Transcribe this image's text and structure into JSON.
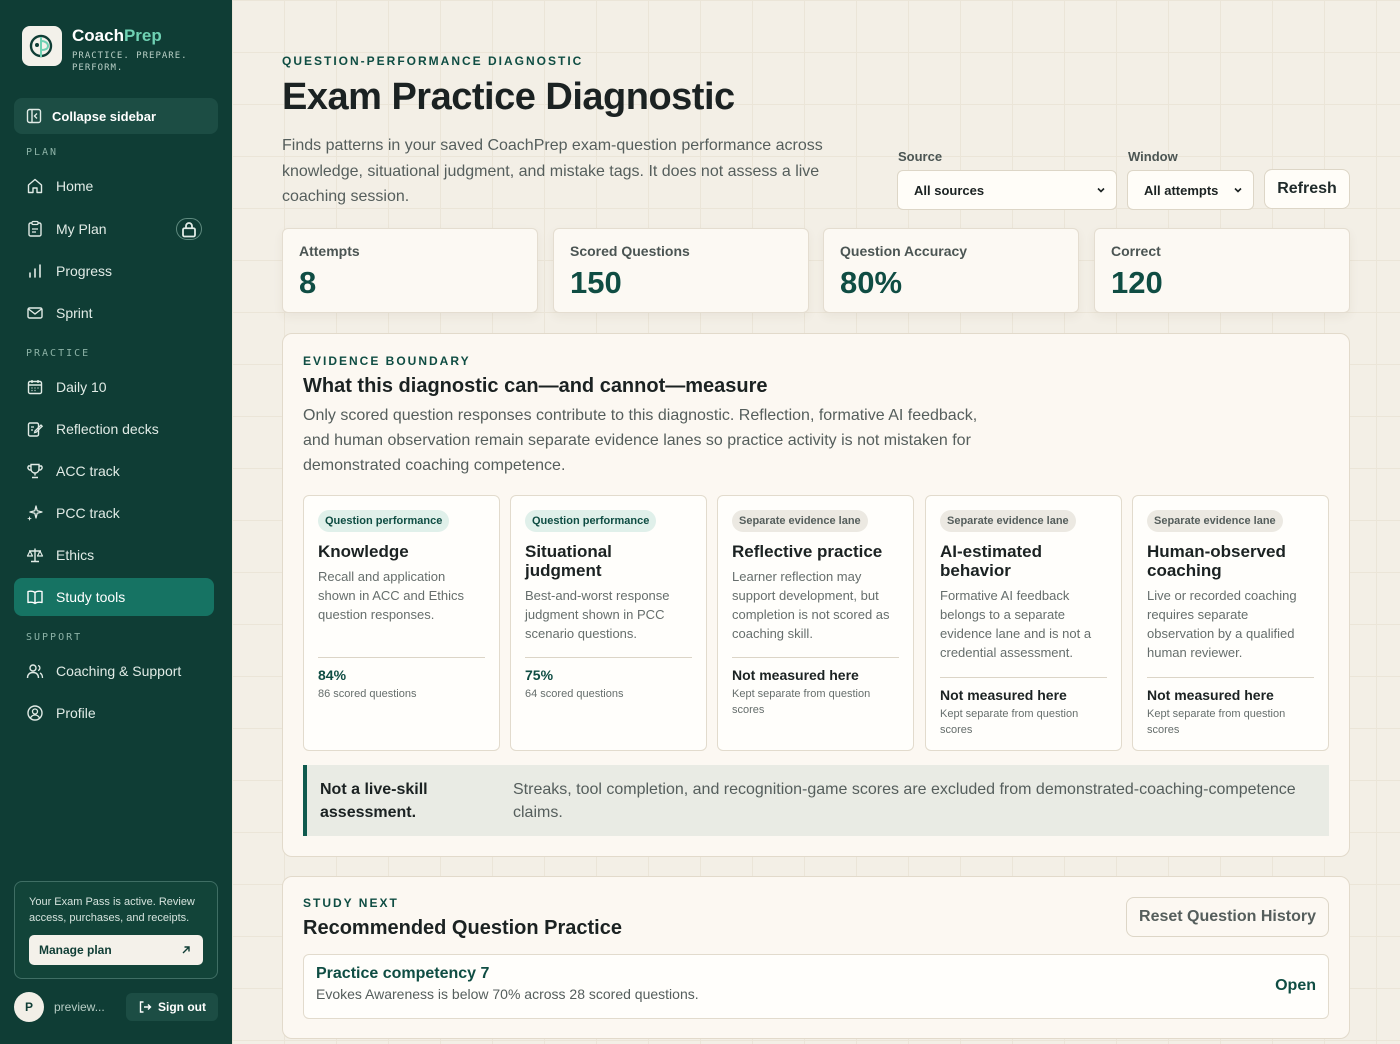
{
  "brand": {
    "name_primary": "Coach",
    "name_accent": "Prep",
    "tagline": "PRACTICE. PREPARE. PERFORM."
  },
  "sidebar": {
    "collapse_label": "Collapse sidebar",
    "sections": {
      "plan": "PLAN",
      "practice": "PRACTICE",
      "support": "SUPPORT"
    },
    "items": [
      {
        "label": "Home",
        "icon": "home-icon"
      },
      {
        "label": "My Plan",
        "icon": "clipboard-icon",
        "locked": true
      },
      {
        "label": "Progress",
        "icon": "bar-chart-icon"
      },
      {
        "label": "Sprint",
        "icon": "mail-icon"
      },
      {
        "label": "Daily 10",
        "icon": "calendar-icon"
      },
      {
        "label": "Reflection decks",
        "icon": "edit-note-icon"
      },
      {
        "label": "ACC track",
        "icon": "trophy-icon"
      },
      {
        "label": "PCC track",
        "icon": "sparkle-icon"
      },
      {
        "label": "Ethics",
        "icon": "scale-icon"
      },
      {
        "label": "Study tools",
        "icon": "book-icon",
        "active": true
      },
      {
        "label": "Coaching & Support",
        "icon": "users-icon"
      },
      {
        "label": "Profile",
        "icon": "user-circle-icon"
      }
    ],
    "pass": {
      "text": "Your Exam Pass is active. Review access, purchases, and receipts.",
      "manage_label": "Manage plan"
    },
    "user": {
      "initial": "P",
      "name": "preview...",
      "signout_label": "Sign out"
    }
  },
  "header": {
    "eyebrow": "QUESTION-PERFORMANCE DIAGNOSTIC",
    "title": "Exam Practice Diagnostic",
    "lede": "Finds patterns in your saved CoachPrep exam-question performance across knowledge, situational judgment, and mistake tags. It does not assess a live coaching session."
  },
  "filters": {
    "source_label": "Source",
    "source_value": "All sources",
    "window_label": "Window",
    "window_value": "All attempts",
    "refresh_label": "Refresh"
  },
  "stats": [
    {
      "label": "Attempts",
      "value": "8"
    },
    {
      "label": "Scored Questions",
      "value": "150"
    },
    {
      "label": "Question Accuracy",
      "value": "80%"
    },
    {
      "label": "Correct",
      "value": "120"
    }
  ],
  "evidence": {
    "eyebrow": "EVIDENCE BOUNDARY",
    "title": "What this diagnostic can—and cannot—measure",
    "text": "Only scored question responses contribute to this diagnostic. Reflection, formative AI feedback, and human observation remain separate evidence lanes so practice activity is not mistaken for demonstrated coaching competence.",
    "lanes": [
      {
        "tag": "Question performance",
        "title": "Knowledge",
        "desc": "Recall and application shown in ACC and Ethics question responses.",
        "metric": "84%",
        "sub": "86 scored questions"
      },
      {
        "tag": "Question performance",
        "title": "Situational judgment",
        "desc": "Best-and-worst response judgment shown in PCC scenario questions.",
        "metric": "75%",
        "sub": "64 scored questions"
      },
      {
        "tag": "Separate evidence lane",
        "title": "Reflective practice",
        "desc": "Learner reflection may support development, but completion is not scored as coaching skill.",
        "metric": "Not measured here",
        "sub": "Kept separate from question scores"
      },
      {
        "tag": "Separate evidence lane",
        "title": "AI-estimated behavior",
        "desc": "Formative AI feedback belongs to a separate evidence lane and is not a credential assessment.",
        "metric": "Not measured here",
        "sub": "Kept separate from question scores"
      },
      {
        "tag": "Separate evidence lane",
        "title": "Human-observed coaching",
        "desc": "Live or recorded coaching requires separate observation by a qualified human reviewer.",
        "metric": "Not measured here",
        "sub": "Kept separate from question scores"
      }
    ],
    "callout_title": "Not a live-skill assessment.",
    "callout_text": "Streaks, tool completion, and recognition-game scores are excluded from demonstrated-coaching-competence claims."
  },
  "study_next": {
    "eyebrow": "STUDY NEXT",
    "title": "Recommended Question Practice",
    "reset_label": "Reset Question History",
    "rec_title": "Practice competency 7",
    "rec_desc": "Evokes Awareness is below 70% across 28 scored questions.",
    "open_label": "Open"
  },
  "colors": {
    "sidebar_bg": "#0f3d35",
    "active_nav": "#167363",
    "accent_text": "#0f4d43",
    "page_bg": "#f3efe6"
  }
}
